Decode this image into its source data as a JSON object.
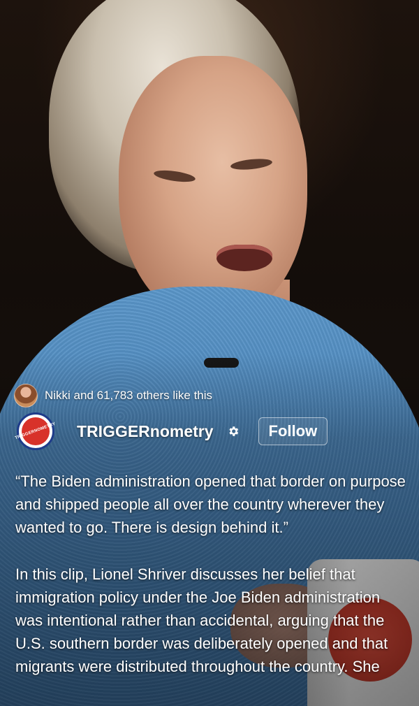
{
  "likes": {
    "text": "Nikki and 61,783 others like this"
  },
  "channel": {
    "name": "TRIGGERnometry",
    "avatar_text": "TRIGGERNOMETRY",
    "follow_label": "Follow"
  },
  "caption": {
    "quote": "“The Biden administration opened that border on purpose and shipped people all over the country wherever they wanted to go. There is design behind it.”",
    "body": "In this clip, Lionel Shriver discusses her belief that immigration policy under the Joe Biden administration was intentional rather than accidental, arguing that the U.S. southern border was deliberately opened and that migrants were distributed throughout the country. She"
  },
  "colors": {
    "sweater": "#4a83b8",
    "brand_red": "#d8322a",
    "brand_blue": "#1e3b8a"
  },
  "icons": {
    "settings": "gear-icon"
  }
}
